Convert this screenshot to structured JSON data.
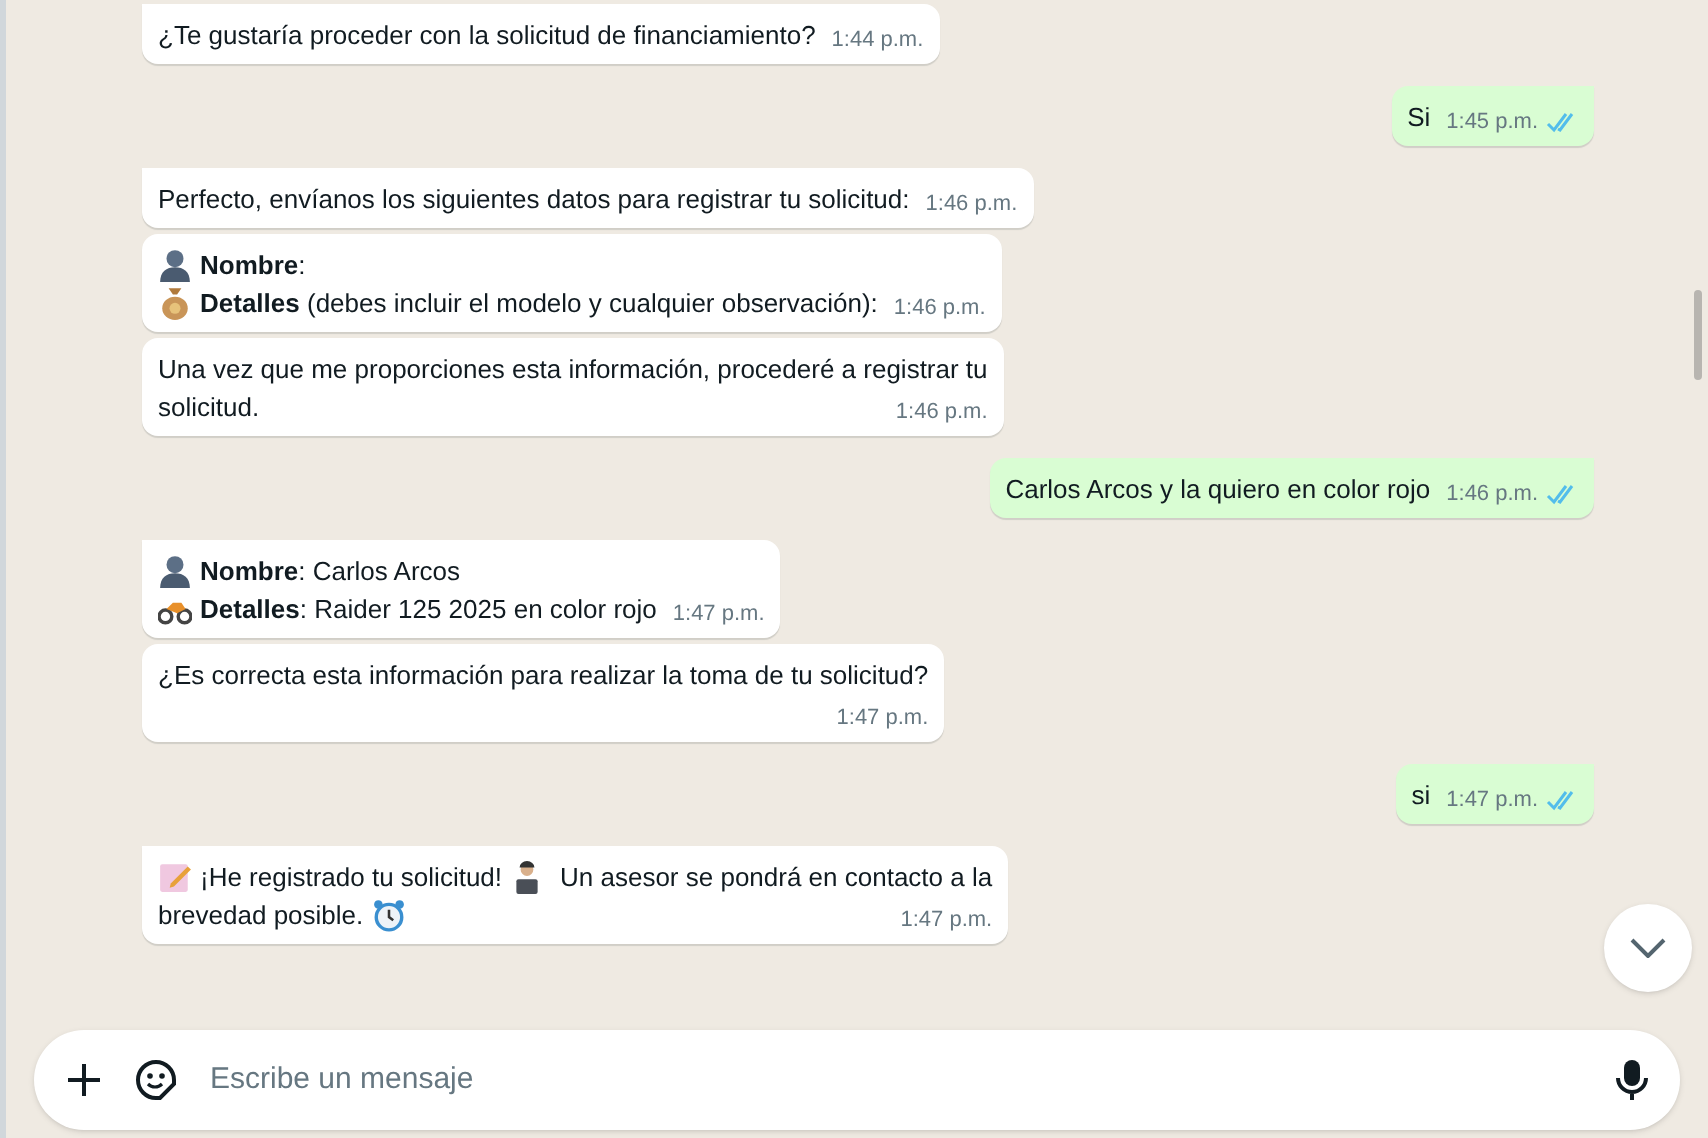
{
  "messages": [
    {
      "kind": "incoming",
      "lines": [
        {
          "text": "¿Te gustaría proceder con la solicitud de financiamiento?"
        }
      ],
      "time": "1:44 p.m."
    },
    {
      "kind": "outgoing",
      "lines": [
        {
          "text": "Si"
        }
      ],
      "time": "1:45 p.m.",
      "read": true
    },
    {
      "kind": "incoming",
      "lines": [
        {
          "text": "Perfecto, envíanos los siguientes datos para registrar tu solicitud:"
        }
      ],
      "time": "1:46 p.m."
    },
    {
      "kind": "incoming",
      "lines": [
        {
          "kind": "person",
          "text": "**Nombre**:"
        },
        {
          "kind": "money",
          "text": "**Detalles** (debes incluir el modelo y cualquier observación):"
        }
      ],
      "time": "1:46 p.m."
    },
    {
      "kind": "incoming",
      "lines": [
        {
          "text": "Una vez que me proporciones esta información, procederé a registrar tu"
        },
        {
          "text": "solicitud."
        }
      ],
      "time": "1:46 p.m."
    },
    {
      "kind": "outgoing",
      "lines": [
        {
          "text": "Carlos Arcos y la quiero en color rojo"
        }
      ],
      "time": "1:46 p.m.",
      "read": true
    },
    {
      "kind": "incoming",
      "lines": [
        {
          "kind": "person",
          "text": "**Nombre**: Carlos Arcos"
        },
        {
          "kind": "motorcycle",
          "text": "**Detalles**: Raider 125 2025 en color rojo"
        }
      ],
      "time": "1:47 p.m."
    },
    {
      "kind": "incoming",
      "lines": [
        {
          "text": "¿Es correcta esta información para realizar la toma de tu solicitud?"
        }
      ],
      "time": "1:47 p.m.",
      "time_row": true
    },
    {
      "kind": "outgoing",
      "lines": [
        {
          "text": "si"
        }
      ],
      "time": "1:47 p.m.",
      "read": true
    },
    {
      "kind": "incoming",
      "lines": [
        {
          "kind": "memo",
          "text": "¡He registrado tu solicitud!",
          "parts": [
            {
              "kind": "laptop"
            },
            {
              "kind": "text",
              "text": "Un asesor se pondrá en contacto a la"
            }
          ]
        },
        {
          "text": "brevedad posible.",
          "parts": [
            {
              "kind": "clock"
            }
          ]
        }
      ],
      "time": "1:47 p.m."
    }
  ],
  "composer": {
    "placeholder": "Escribe un mensaje"
  }
}
